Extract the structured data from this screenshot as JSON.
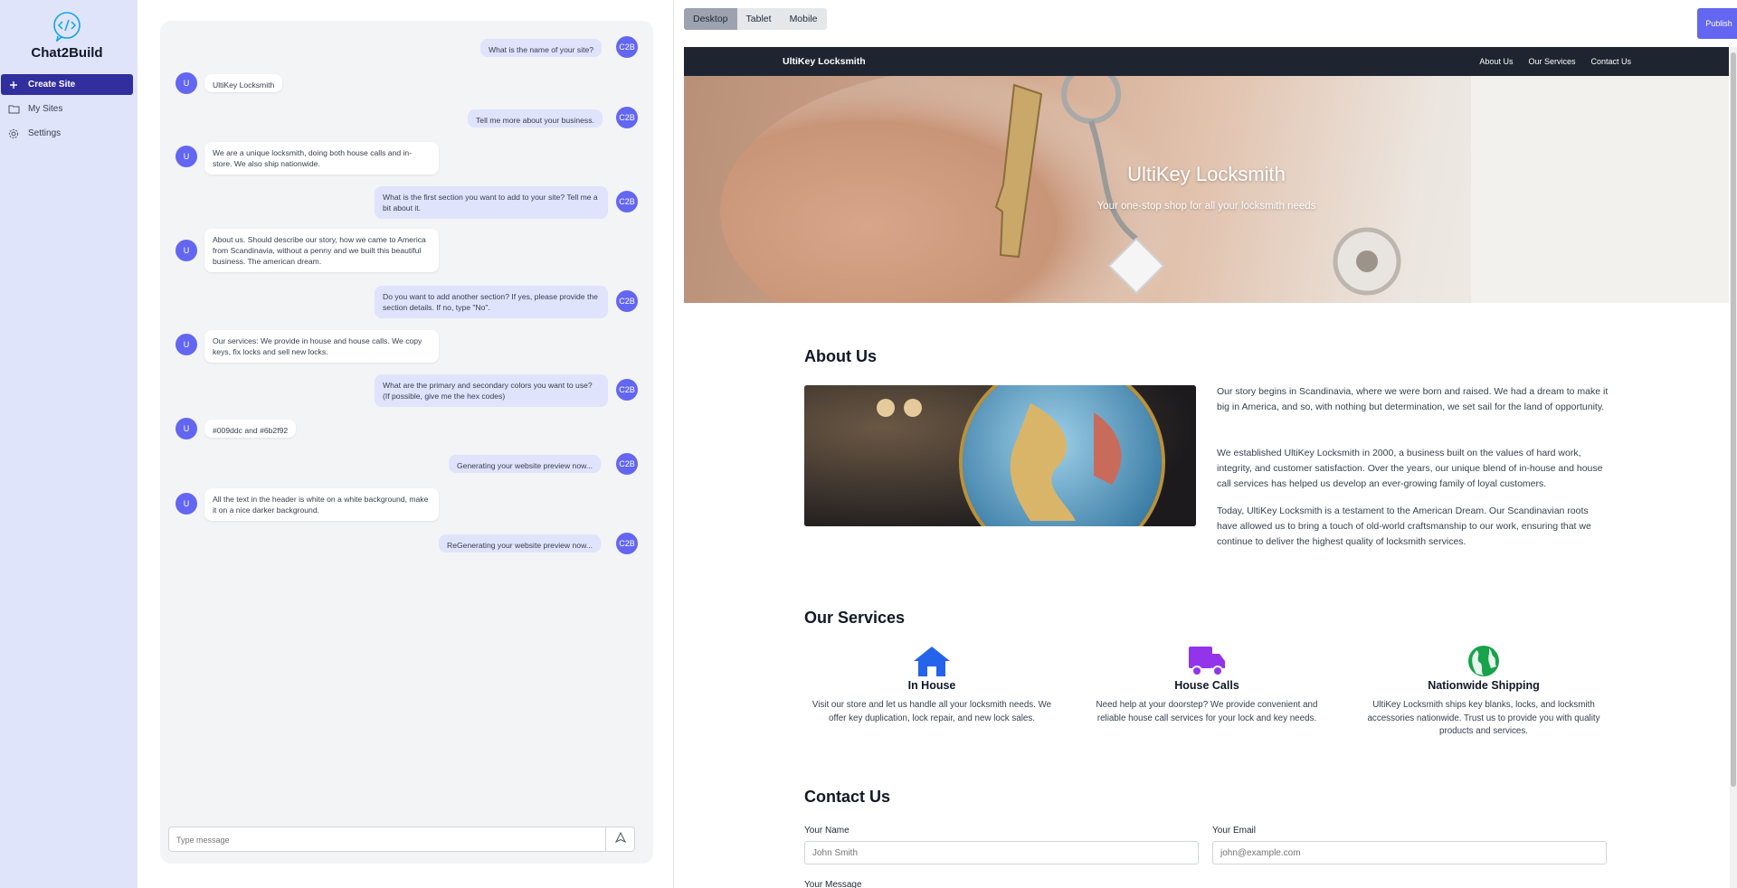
{
  "app": {
    "name": "Chat2Build"
  },
  "sidebar": {
    "items": [
      {
        "label": "Create Site",
        "icon": "plus-icon",
        "active": true
      },
      {
        "label": "My Sites",
        "icon": "folder-icon",
        "active": false
      },
      {
        "label": "Settings",
        "icon": "gear-icon",
        "active": false
      }
    ]
  },
  "chat": {
    "bot_avatar": "C2B",
    "user_avatar": "U",
    "messages": [
      {
        "from": "bot",
        "text": "What is the name of your site?"
      },
      {
        "from": "user",
        "text": "UltiKey Locksmith"
      },
      {
        "from": "bot",
        "text": "Tell me more about your business."
      },
      {
        "from": "user",
        "text": "We are a unique locksmith, doing both house calls and in-store. We also ship nationwide."
      },
      {
        "from": "bot",
        "text": "What is the first section you want to add to your site? Tell me a bit about it."
      },
      {
        "from": "user",
        "text": "About us. Should describe our story, how we came to America from Scandinavia, without a penny and we built this beautiful business. The american dream."
      },
      {
        "from": "bot",
        "text": "Do you want to add another section? If yes, please provide the section details. If no, type \"No\"."
      },
      {
        "from": "user",
        "text": "Our services: We provide in house and house calls. We copy keys, fix locks and sell new locks."
      },
      {
        "from": "bot",
        "text": "What are the primary and secondary colors you want to use? (If possible, give me the hex codes)"
      },
      {
        "from": "user",
        "text": "#009ddc and #6b2f92"
      },
      {
        "from": "bot",
        "text": "Generating your website preview now..."
      },
      {
        "from": "user",
        "text": "All the text in the header is white on a white background, make it on a nice darker background."
      },
      {
        "from": "bot",
        "text": "ReGenerating your website preview now..."
      }
    ],
    "input_placeholder": "Type message",
    "send_icon": "send-icon"
  },
  "preview": {
    "tabs": [
      {
        "label": "Desktop",
        "active": true
      },
      {
        "label": "Tablet",
        "active": false
      },
      {
        "label": "Mobile",
        "active": false
      }
    ],
    "publish_label": "Publish"
  },
  "site": {
    "brand": "UltiKey Locksmith",
    "nav_links": [
      "About Us",
      "Our Services",
      "Contact Us"
    ],
    "hero": {
      "title": "UltiKey Locksmith",
      "subtitle": "Your one-stop shop for all your locksmith needs"
    },
    "about": {
      "heading": "About Us",
      "paragraphs": [
        "Our story begins in Scandinavia, where we were born and raised. We had a dream to make it big in America, and so, with nothing but determination, we set sail for the land of opportunity.",
        "We established UltiKey Locksmith in 2000, a business built on the values of hard work, integrity, and customer satisfaction. Over the years, our unique blend of in-house and house call services has helped us develop an ever-growing family of loyal customers.",
        "Today, UltiKey Locksmith is a testament to the American Dream. Our Scandinavian roots have allowed us to bring a touch of old-world craftsmanship to our work, ensuring that we continue to deliver the highest quality of locksmith services."
      ]
    },
    "services": {
      "heading": "Our Services",
      "items": [
        {
          "title": "In House",
          "icon": "house-icon",
          "color": "#2563eb",
          "desc": "Visit our store and let us handle all your locksmith needs. We offer key duplication, lock repair, and new lock sales."
        },
        {
          "title": "House Calls",
          "icon": "truck-icon",
          "color": "#9333ea",
          "desc": "Need help at your doorstep? We provide convenient and reliable house call services for your lock and key needs."
        },
        {
          "title": "Nationwide Shipping",
          "icon": "globe-icon",
          "color": "#16a34a",
          "desc": "UltiKey Locksmith ships key blanks, locks, and locksmith accessories nationwide. Trust us to provide you with quality products and services."
        }
      ]
    },
    "contact": {
      "heading": "Contact Us",
      "name_label": "Your Name",
      "name_placeholder": "John Smith",
      "email_label": "Your Email",
      "email_placeholder": "john@example.com",
      "message_label": "Your Message"
    }
  },
  "colors": {
    "accent": "#6366f1",
    "sidebar_bg": "#e0e4fb",
    "active_nav": "#312e9e",
    "site_nav_bg": "#1e2530"
  }
}
